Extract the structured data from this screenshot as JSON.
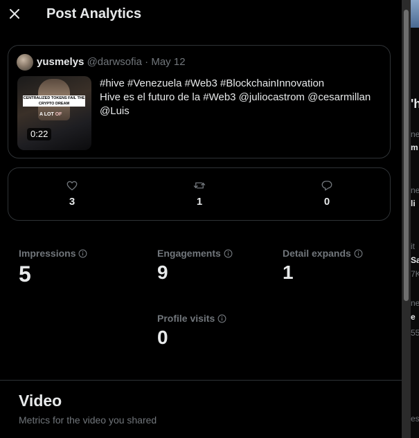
{
  "header": {
    "title": "Post Analytics",
    "close_icon": "close-icon"
  },
  "post": {
    "author_name": "yusmelys",
    "author_handle": "@darwsofia",
    "separator": "·",
    "date": "May 12",
    "text_line1": "#hive #Venezuela #Web3 #BlockchainInnovation",
    "text_line2": "Hive es el futuro de la #Web3 @juliocastrom @cesarmillan",
    "text_line3": "@Luis",
    "thumbnail": {
      "banner": "CENTRALIZED TOKENS FAIL THE CRYPTO DREAM",
      "caption_a": "A LOT",
      "caption_b": "OF",
      "duration": "0:22"
    }
  },
  "engagement_stats": {
    "likes": {
      "icon": "heart-icon",
      "value": "3"
    },
    "reposts": {
      "icon": "repost-icon",
      "value": "1"
    },
    "replies": {
      "icon": "reply-icon",
      "value": "0"
    }
  },
  "metrics": {
    "impressions": {
      "label": "Impressions",
      "value": "5"
    },
    "engagements": {
      "label": "Engagements",
      "value": "9"
    },
    "detail_expands": {
      "label": "Detail expands",
      "value": "1"
    },
    "profile_visits": {
      "label": "Profile visits",
      "value": "0"
    }
  },
  "video_section": {
    "title": "Video",
    "subtitle": "Metrics for the video you shared"
  },
  "background_fragments": [
    "'h",
    "ne",
    "m",
    "ne",
    "li",
    "it",
    "Sa",
    "7K",
    "ne",
    "e",
    "55",
    "es"
  ],
  "colors": {
    "background": "#000000",
    "text": "#e7e9ea",
    "muted": "#71767b",
    "border": "#2f3336",
    "accent": "#1d9bf0"
  }
}
